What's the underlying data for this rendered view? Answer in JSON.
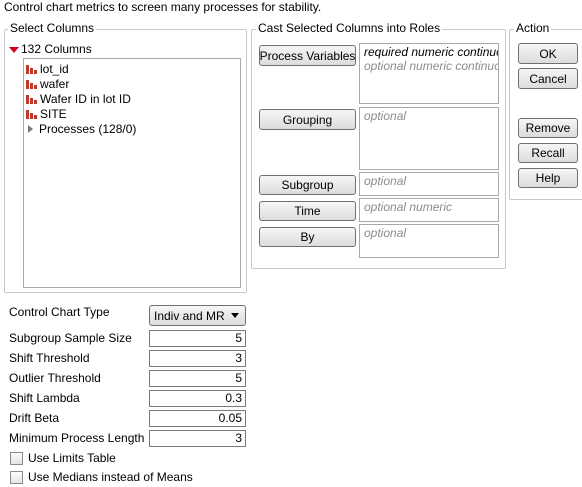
{
  "description": "Control chart metrics to screen many processes for stability.",
  "select_columns": {
    "title": "Select Columns",
    "count_label": "132 Columns",
    "items": [
      {
        "label": "lot_id",
        "icon": "continuous-column-icon"
      },
      {
        "label": "wafer",
        "icon": "continuous-column-icon"
      },
      {
        "label": "Wafer ID in lot ID",
        "icon": "continuous-column-icon"
      },
      {
        "label": "SITE",
        "icon": "continuous-column-icon"
      }
    ],
    "group_label": "Processes (128/0)"
  },
  "cast_roles": {
    "title": "Cast Selected Columns into Roles",
    "roles": [
      {
        "button": "Process Variables",
        "lines": [
          "required numeric continuous",
          "optional numeric continuous"
        ]
      },
      {
        "button": "Grouping",
        "lines": [
          "optional"
        ]
      },
      {
        "button": "Subgroup",
        "lines": [
          "optional"
        ]
      },
      {
        "button": "Time",
        "lines": [
          "optional numeric"
        ]
      },
      {
        "button": "By",
        "lines": [
          "optional"
        ]
      }
    ]
  },
  "action": {
    "title": "Action",
    "ok": "OK",
    "cancel": "Cancel",
    "remove": "Remove",
    "recall": "Recall",
    "help": "Help"
  },
  "options": {
    "chart_type_label": "Control Chart Type",
    "chart_type_value": "Indiv and MR",
    "fields": [
      {
        "label": "Subgroup Sample Size",
        "value": "5"
      },
      {
        "label": "Shift Threshold",
        "value": "3"
      },
      {
        "label": "Outlier Threshold",
        "value": "5"
      },
      {
        "label": "Shift Lambda",
        "value": "0.3"
      },
      {
        "label": "Drift Beta",
        "value": "0.05"
      },
      {
        "label": "Minimum Process Length",
        "value": "3"
      }
    ],
    "checkboxes": [
      {
        "label": "Use Limits Table",
        "checked": false
      },
      {
        "label": "Use Medians instead of Means",
        "checked": false
      }
    ]
  },
  "colors": {
    "column_icon": "#c0392b",
    "red_triangle": "#d0021b"
  }
}
